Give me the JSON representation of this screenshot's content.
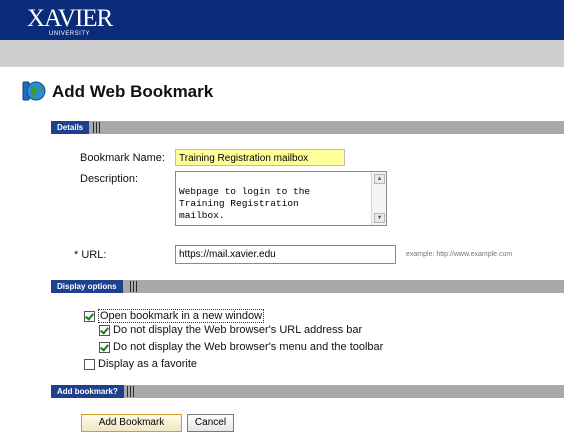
{
  "header": {
    "logo_main": "XAVIER",
    "logo_sub": "UNIVERSITY"
  },
  "page": {
    "title": "Add Web Bookmark",
    "icon": "globe-bookmark-icon"
  },
  "sections": {
    "details": "Details",
    "display_options": "Display options",
    "add_bookmark": "Add bookmark?"
  },
  "form": {
    "name_label": "Bookmark Name:",
    "name_value": "Training Registration mailbox",
    "description_label": "Description:",
    "description_value": "Webpage to login to the\nTraining Registration\nmailbox.",
    "url_label": "* URL:",
    "url_value": "https://mail.xavier.edu",
    "url_example": "example: http://www.example.com"
  },
  "options": [
    {
      "label": "Open bookmark in a new window",
      "checked": true
    },
    {
      "label": "Do not display the Web browser's URL address bar",
      "checked": true
    },
    {
      "label": "Do not display the Web browser's menu and the toolbar",
      "checked": true
    },
    {
      "label": "Display as a favorite",
      "checked": false
    }
  ],
  "buttons": {
    "add": "Add Bookmark",
    "cancel": "Cancel"
  },
  "colors": {
    "header_bg": "#0b2c7a",
    "section_label_bg": "#1f3f8f",
    "name_field_highlight": "#ffff99"
  }
}
